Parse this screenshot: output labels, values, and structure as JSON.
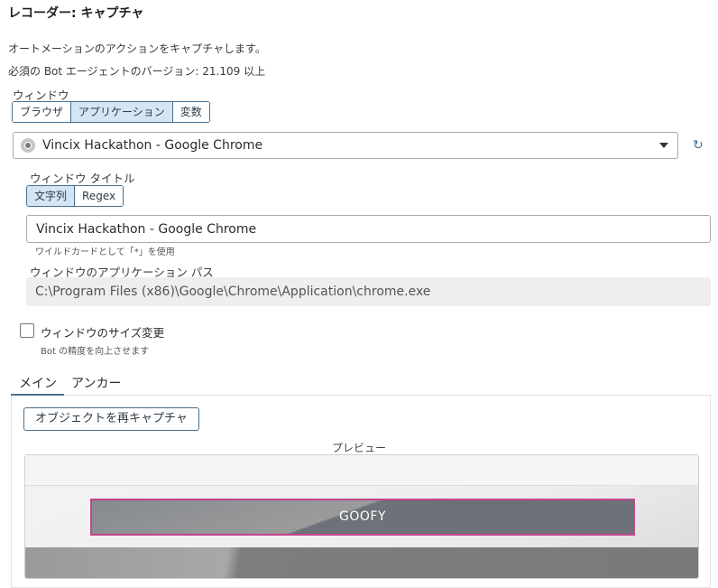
{
  "header": {
    "title": "レコーダー: キャプチャ",
    "description": "オートメーションのアクションをキャプチャします。",
    "requirement": "必須の Bot エージェントのバージョン: 21.109 以上"
  },
  "window_section": {
    "label": "ウィンドウ",
    "segments": [
      "ブラウザ",
      "アプリケーション",
      "変数"
    ],
    "active_segment": "アプリケーション",
    "selected_window": "Vincix Hackathon - Google Chrome"
  },
  "title_section": {
    "label": "ウィンドウ タイトル",
    "segments": [
      "文字列",
      "Regex"
    ],
    "active_segment": "文字列",
    "value": "Vincix Hackathon - Google Chrome",
    "hint": "ワイルドカードとして「*」を使用"
  },
  "path_section": {
    "label": "ウィンドウのアプリケーション パス",
    "value": "C:\\Program Files (x86)\\Google\\Chrome\\Application\\chrome.exe"
  },
  "resize": {
    "label": "ウィンドウのサイズ変更",
    "hint": "Bot の精度を向上させます",
    "checked": false
  },
  "tabs": {
    "main": "メイン",
    "anchor": "アンカー"
  },
  "main_panel": {
    "recapture_label": "オブジェクトを再キャプチャ",
    "preview_label": "プレビュー",
    "preview_element_text": "GOOFY"
  },
  "icons": {
    "app_icon": "chrome-icon",
    "dropdown": "chevron-down-icon",
    "refresh": "refresh-icon"
  },
  "colors": {
    "accent": "#4a6f8f",
    "active_segment_bg": "#d4e5f4",
    "highlight_border": "#c2458d"
  }
}
